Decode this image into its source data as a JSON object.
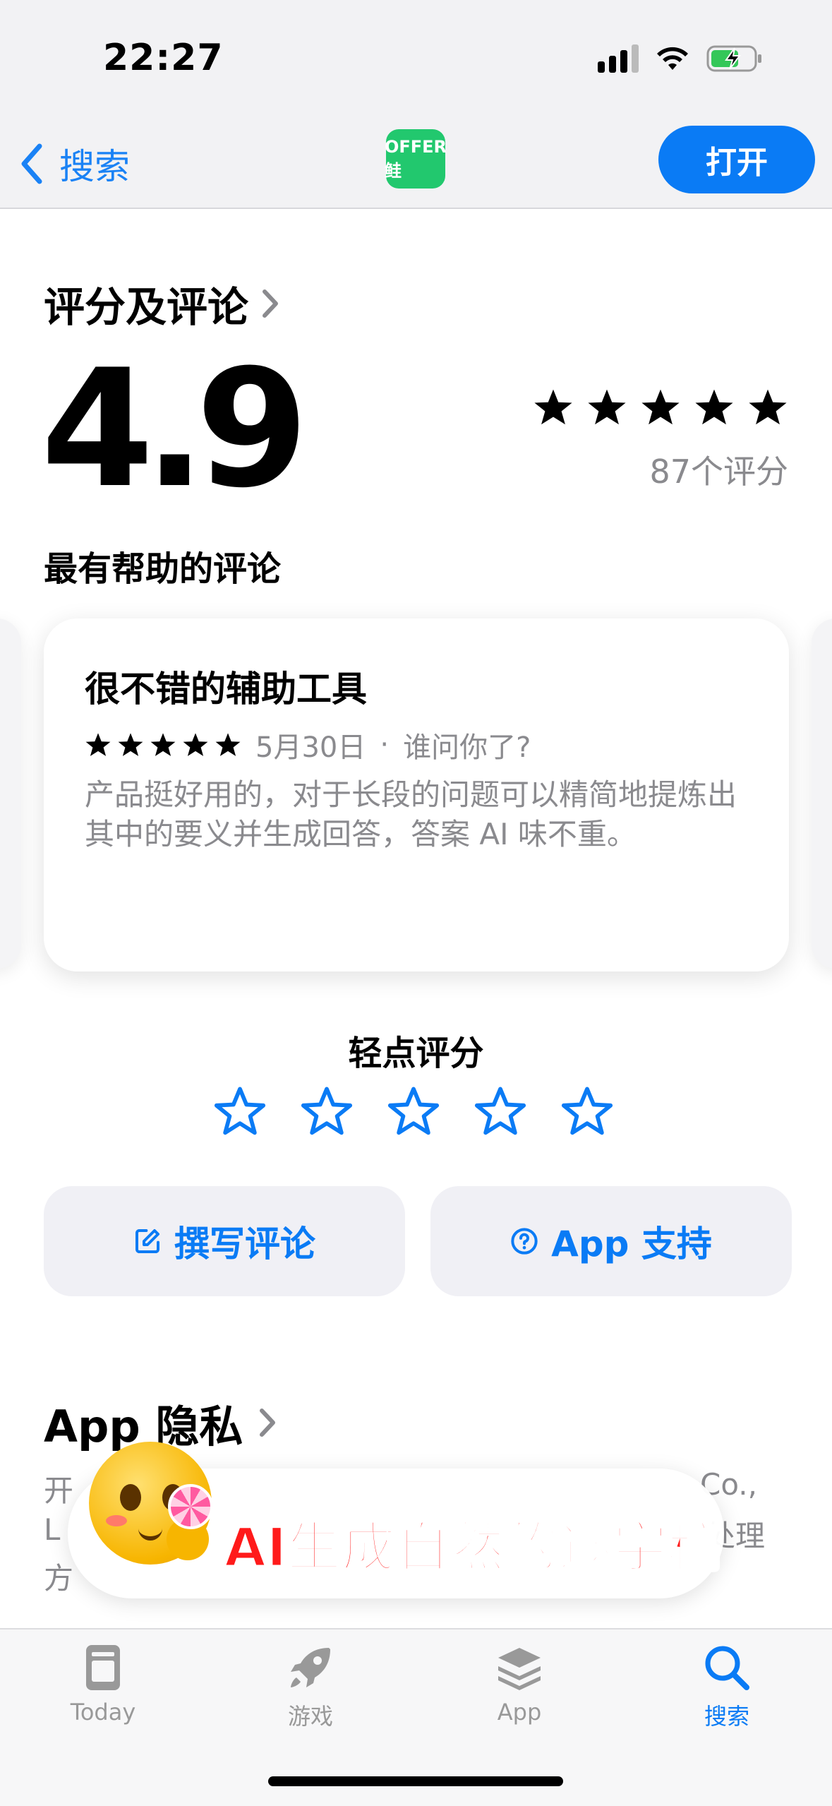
{
  "status": {
    "time": "22:27"
  },
  "nav": {
    "back_label": "搜索",
    "app_icon_text": "OFFER鲑",
    "open_label": "打开"
  },
  "ratings": {
    "section_title": "评分及评论",
    "average": "4.9",
    "count_label": "87个评分",
    "helpful_title": "最有帮助的评论"
  },
  "review": {
    "title": "很不错的辅助工具",
    "stars": 5,
    "date": "5月30日",
    "separator": "·",
    "author": "谁问你了?",
    "body": "产品挺好用的，对于长段的问题可以精简地提炼出其中的要义并生成回答，答案 AI 味不重。"
  },
  "tap_to_rate": {
    "label": "轻点评分"
  },
  "actions": {
    "write_review": "撰写评论",
    "app_support": "App 支持"
  },
  "privacy": {
    "title": "App 隐私",
    "fragments": [
      "开",
      "Co.,",
      "L",
      "处理",
      "方"
    ]
  },
  "overlay": {
    "caption": "AI生成自然的逐字稿"
  },
  "tabs": [
    {
      "label": "Today",
      "icon": "today-icon"
    },
    {
      "label": "游戏",
      "icon": "rocket-icon"
    },
    {
      "label": "App",
      "icon": "apps-stack-icon"
    },
    {
      "label": "搜索",
      "icon": "search-icon",
      "active": true
    }
  ],
  "colors": {
    "accent": "#0a7bf5",
    "app_icon": "#22c86e",
    "caption": "#ff1a1a"
  }
}
